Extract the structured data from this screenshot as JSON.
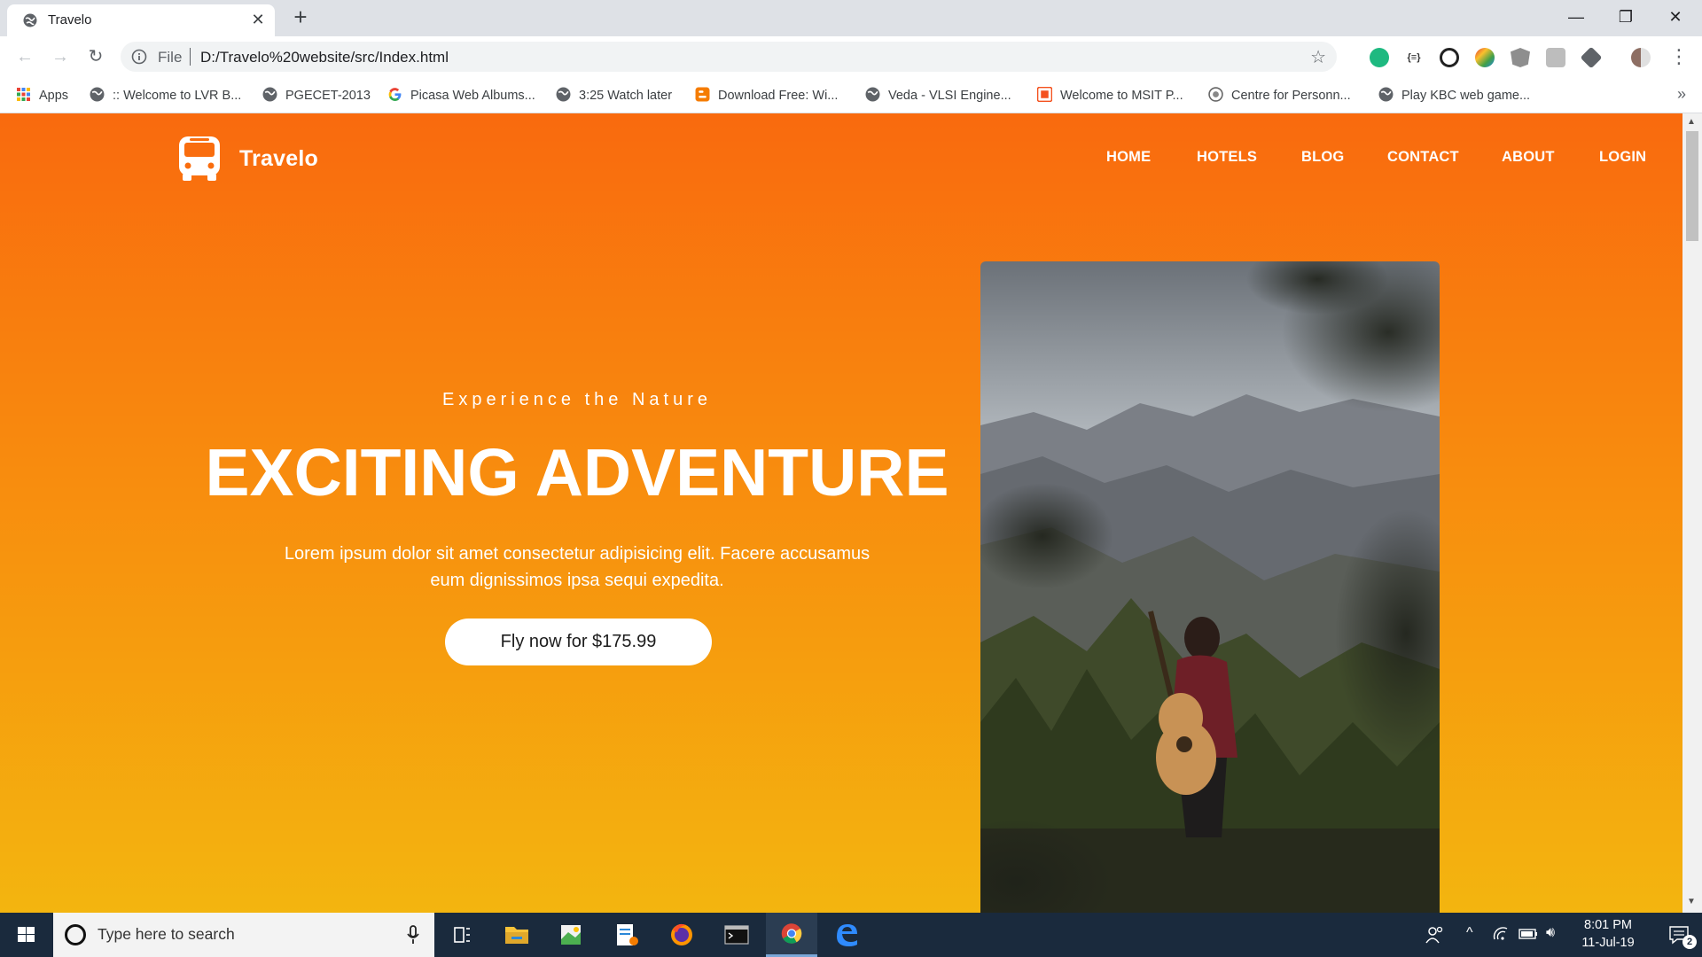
{
  "browser": {
    "tab_title": "Travelo",
    "new_tab_label": "+",
    "url_scheme": "File",
    "url": "D:/Travelo%20website/src/Index.html",
    "bookmarks": [
      {
        "label": "Apps",
        "icon": "apps-grid-icon"
      },
      {
        "label": ":: Welcome to LVR B...",
        "icon": "globe-icon"
      },
      {
        "label": "PGECET-2013",
        "icon": "globe-icon"
      },
      {
        "label": "Picasa Web Albums...",
        "icon": "google-icon"
      },
      {
        "label": "3:25 Watch later",
        "icon": "globe-icon"
      },
      {
        "label": "Download Free: Wi...",
        "icon": "blogger-icon"
      },
      {
        "label": "Veda - VLSI Engine...",
        "icon": "globe-icon"
      },
      {
        "label": "Welcome to MSIT P...",
        "icon": "msit-icon"
      },
      {
        "label": "Centre for Personn...",
        "icon": "emblem-icon"
      },
      {
        "label": "Play KBC web game...",
        "icon": "globe-icon"
      }
    ],
    "bookmarks_more": "»"
  },
  "site": {
    "brand": "Travelo",
    "nav": [
      "HOME",
      "HOTELS",
      "BLOG",
      "CONTACT",
      "ABOUT",
      "LOGIN"
    ],
    "hero": {
      "eyebrow": "Experience the Nature",
      "title": "EXCITING ADVENTURE",
      "text_line1": "Lorem ipsum dolor sit amet consectetur adipisicing elit. Facere accusamus",
      "text_line2": "eum dignissimos ipsa sequi expedita.",
      "cta": "Fly now for $175.99"
    },
    "colors": {
      "gradient_top": "#f96a0e",
      "gradient_bottom": "#f3b50f"
    }
  },
  "taskbar": {
    "search_placeholder": "Type here to search",
    "time": "8:01 PM",
    "date": "11-Jul-19",
    "notification_count": "2"
  }
}
